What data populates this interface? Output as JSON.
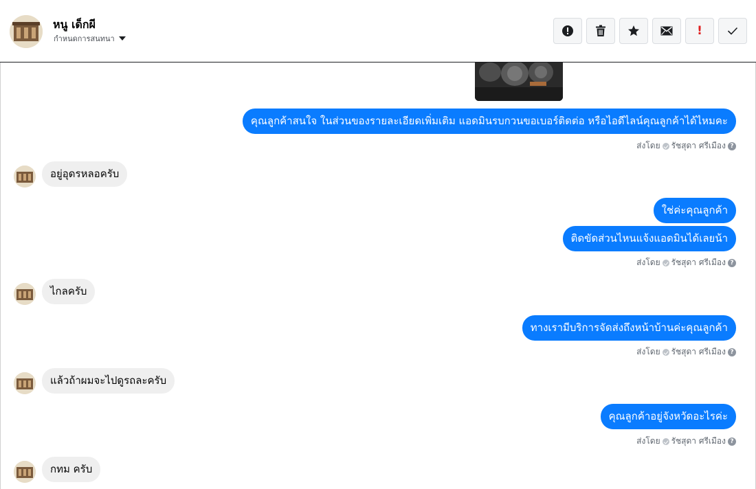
{
  "header": {
    "contact_name": "หนู เด็กผี",
    "assign_label": "กำหนดการสนทนา"
  },
  "toolbar": {
    "buttons": [
      {
        "name": "report-button",
        "icon": "alert-circle-icon"
      },
      {
        "name": "delete-button",
        "icon": "trash-icon"
      },
      {
        "name": "star-button",
        "icon": "star-icon"
      },
      {
        "name": "mark-unread-button",
        "icon": "envelope-icon"
      },
      {
        "name": "important-button",
        "icon": "exclamation-icon",
        "glyph": "!"
      },
      {
        "name": "done-button",
        "icon": "check-icon"
      }
    ]
  },
  "colors": {
    "outgoing_bubble": "#0a7cff",
    "incoming_bubble": "#efefef",
    "important_mark": "#e02020"
  },
  "messages": {
    "out_1": "คุณลูกค้าสนใจ ในส่วนของรายละเอียดเพิ่มเติม แอดมินรบกวนขอเบอร์ติดต่อ หรือไอดีไลน์คุณลูกค้าได้ไหมคะ",
    "in_1": "อยู่อุดรหลอครับ",
    "out_2": "ใช่ค่ะคุณลูกค้า",
    "out_3": "ติดขัดส่วนไหนแจ้งแอดมินได้เลยน้า",
    "in_2": "ไกลครับ",
    "out_4": "ทางเรามีบริการจัดส่งถึงหน้าบ้านค่ะคุณลูกค้า",
    "in_3": "แล้วถ้าผมจะไปดูรถละครับ",
    "out_5": "คุณลูกค้าอยู่จังหวัดอะไรค่ะ",
    "in_4": "กทม ครับ"
  },
  "sent_by": {
    "prefix": "ส่งโดย",
    "agent": "รัชสุดา ศรีเมือง"
  }
}
